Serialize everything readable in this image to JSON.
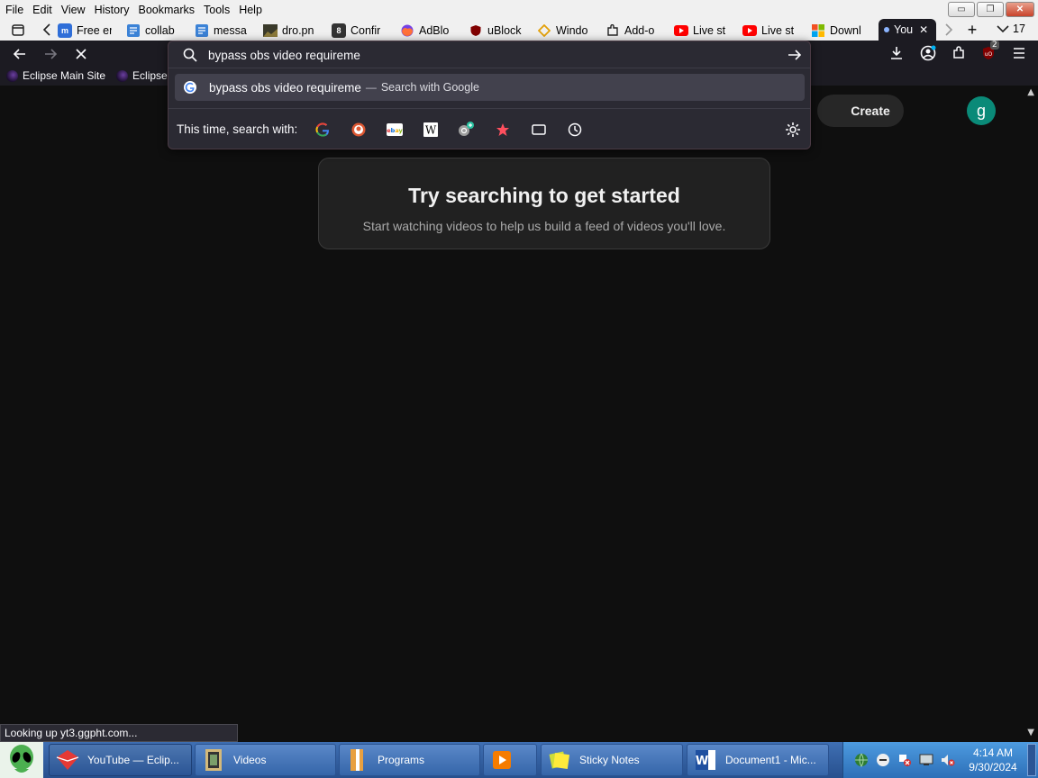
{
  "menu": [
    "File",
    "Edit",
    "View",
    "History",
    "Bookmarks",
    "Tools",
    "Help"
  ],
  "menu_accel": [
    "F",
    "E",
    "V",
    "s",
    "B",
    "T",
    "H"
  ],
  "tabs": [
    {
      "label": "Free er",
      "icon": "m-icon",
      "color": "#2f6ed8"
    },
    {
      "label": "collab",
      "icon": "doc-icon",
      "color": "#3b82d6"
    },
    {
      "label": "messa",
      "icon": "doc-icon",
      "color": "#3b82d6"
    },
    {
      "label": "dro.pn",
      "icon": "image-icon",
      "color": "#333"
    },
    {
      "label": "Confir",
      "icon": "b-icon",
      "color": "#333"
    },
    {
      "label": "AdBlo",
      "icon": "firefox-icon",
      "color": "#e66000"
    },
    {
      "label": "uBlock",
      "icon": "ublock-icon",
      "color": "#800000"
    },
    {
      "label": "Windo",
      "icon": "diamond-icon",
      "color": "#e3a008"
    },
    {
      "label": "Add-o",
      "icon": "puzzle-icon",
      "color": "#444"
    },
    {
      "label": "Live st",
      "icon": "youtube-icon",
      "color": "#ff0000"
    },
    {
      "label": "Live st",
      "icon": "youtube-icon",
      "color": "#ff0000"
    },
    {
      "label": "Downl",
      "icon": "windows-icon",
      "color": "#f25022"
    },
    {
      "label": "You",
      "icon": "youtube-icon",
      "color": "#ff0000",
      "active": true
    }
  ],
  "tab_count": "17",
  "bookmarks": [
    "Eclipse Main Site",
    "Eclipse"
  ],
  "urlbar": {
    "value": "bypass obs video requireme",
    "suggestion_text": "bypass obs video requireme",
    "suggestion_sep": "—",
    "suggestion_action": "Search with Google",
    "engines_label": "This time, search with:"
  },
  "page": {
    "create_label": "Create",
    "avatar_letter": "g",
    "empty_title": "Try searching to get started",
    "empty_subtitle": "Start watching videos to help us build a feed of videos you'll love."
  },
  "status": "Looking up yt3.ggpht.com...",
  "ublock_badge": "2",
  "taskbar": {
    "items": [
      {
        "label": "YouTube — Eclip...",
        "active": true
      },
      {
        "label": "Videos"
      },
      {
        "label": "Programs"
      },
      {
        "label": ""
      },
      {
        "label": "Sticky Notes"
      },
      {
        "label": "Document1 - Mic..."
      }
    ],
    "time": "4:14 AM",
    "date": "9/30/2024"
  }
}
